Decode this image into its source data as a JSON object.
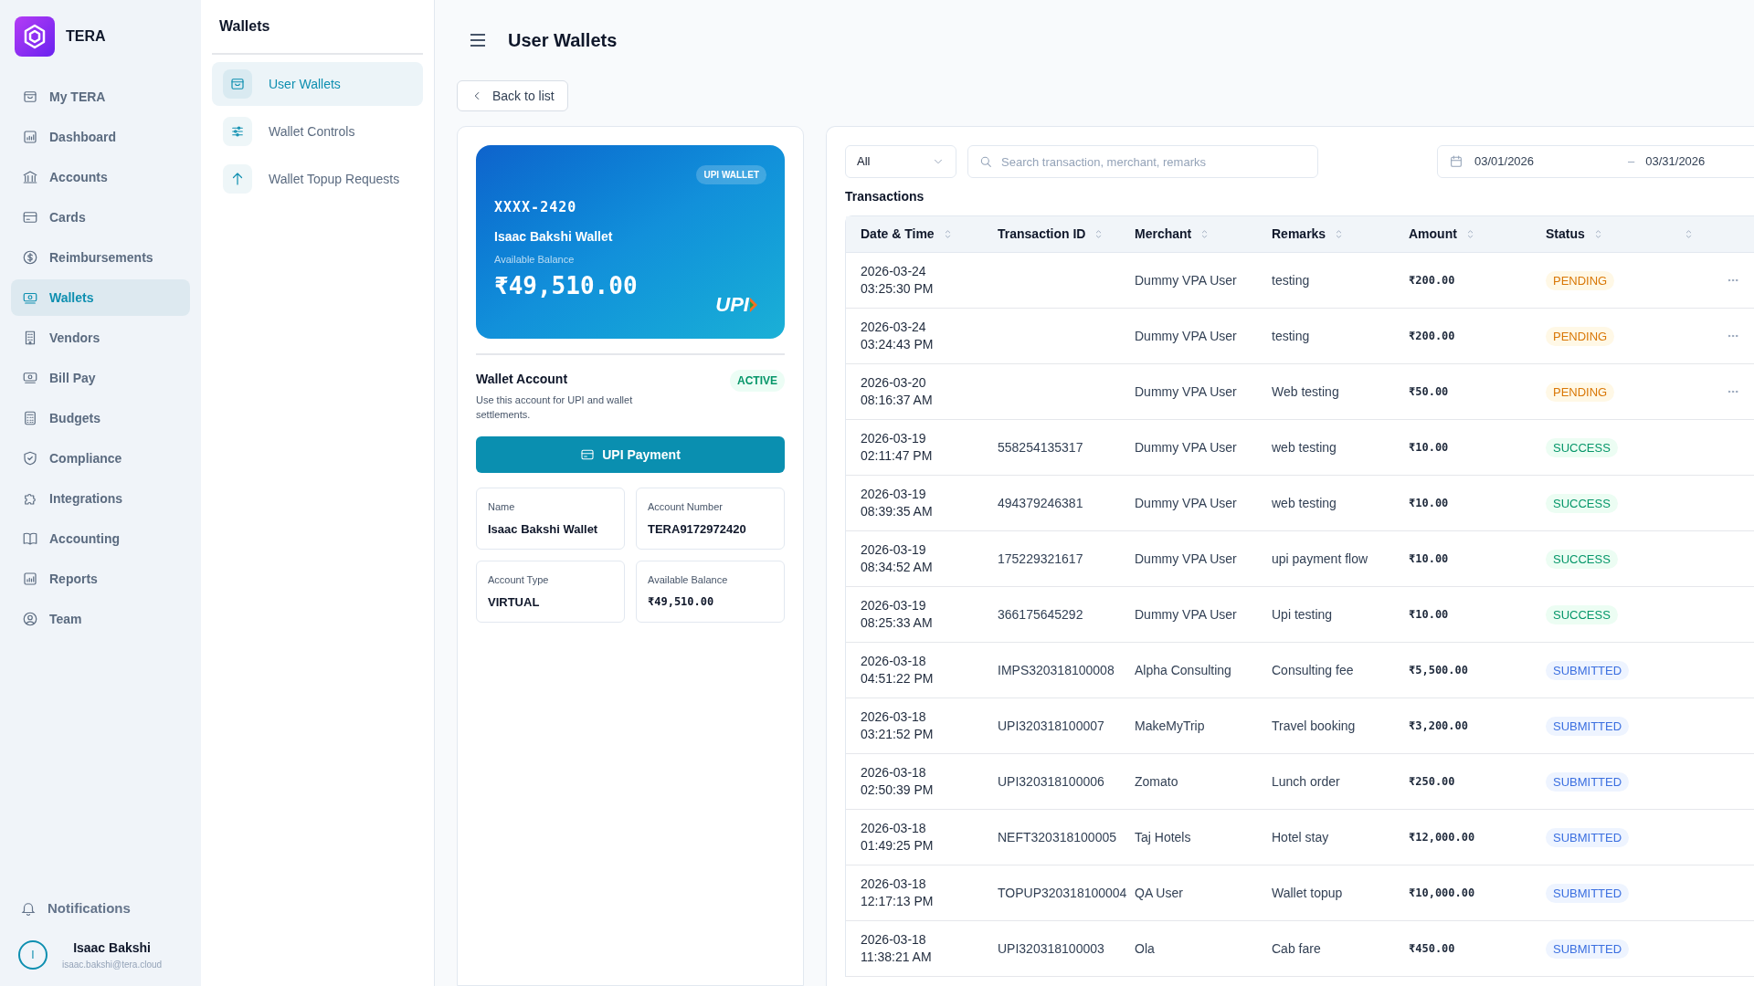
{
  "sidebar": {
    "brand": "TERA",
    "items": [
      {
        "label": "My TERA",
        "selected": false
      },
      {
        "label": "Dashboard",
        "selected": false
      },
      {
        "label": "Accounts",
        "selected": false
      },
      {
        "label": "Cards",
        "selected": false
      },
      {
        "label": "Reimbursements",
        "selected": false
      },
      {
        "label": "Wallets",
        "selected": true
      },
      {
        "label": "Vendors",
        "selected": false
      },
      {
        "label": "Bill Pay",
        "selected": false
      },
      {
        "label": "Budgets",
        "selected": false
      },
      {
        "label": "Compliance",
        "selected": false
      },
      {
        "label": "Integrations",
        "selected": false
      },
      {
        "label": "Accounting",
        "selected": false
      },
      {
        "label": "Reports",
        "selected": false
      },
      {
        "label": "Team",
        "selected": false
      }
    ],
    "notifications": "Notifications",
    "user": {
      "initial": "I",
      "name": "Isaac Bakshi",
      "email": "isaac.bakshi@tera.cloud"
    }
  },
  "subnav": {
    "title": "Wallets",
    "items": [
      {
        "label": "User Wallets",
        "selected": true
      },
      {
        "label": "Wallet Controls",
        "selected": false
      },
      {
        "label": "Wallet Topup Requests",
        "selected": false
      }
    ]
  },
  "header": {
    "title": "User Wallets",
    "back": "Back to list"
  },
  "wallet_card": {
    "badge": "UPI WALLET",
    "number": "XXXX-2420",
    "name": "Isaac Bakshi Wallet",
    "balance_label": "Available Balance",
    "balance": "₹49,510.00",
    "logo": "UPI"
  },
  "account": {
    "title": "Wallet Account",
    "status": "ACTIVE",
    "description": "Use this account for UPI and wallet settlements.",
    "button": "UPI Payment",
    "fields": [
      {
        "label": "Name",
        "value": "Isaac Bakshi Wallet",
        "kind": "text"
      },
      {
        "label": "Account Number",
        "value": "TERA9172972420",
        "kind": "text"
      },
      {
        "label": "Account Type",
        "value": "VIRTUAL",
        "kind": "text"
      },
      {
        "label": "Available Balance",
        "value": "₹49,510.00",
        "kind": "amount"
      }
    ]
  },
  "filters": {
    "type": "All",
    "search_placeholder": "Search transaction, merchant, remarks",
    "date_from": "03/01/2026",
    "date_separator": "–",
    "date_to": "03/31/2026"
  },
  "transactions": {
    "title": "Transactions",
    "columns": [
      "Date & Time",
      "Transaction ID",
      "Merchant",
      "Remarks",
      "Amount",
      "Status"
    ],
    "rows": [
      {
        "date": "2026-03-24",
        "time": "03:25:30 PM",
        "merchant": "Dummy VPA User",
        "remarks": "testing",
        "amount": "₹200.00",
        "status": "PENDING",
        "kind": "pending",
        "menu": true
      },
      {
        "date": "2026-03-24",
        "time": "03:24:43 PM",
        "merchant": "Dummy VPA User",
        "remarks": "testing",
        "amount": "₹200.00",
        "status": "PENDING",
        "kind": "pending",
        "menu": true
      },
      {
        "date": "2026-03-20",
        "time": "08:16:37 AM",
        "merchant": "Dummy VPA User",
        "remarks": "Web testing",
        "amount": "₹50.00",
        "status": "PENDING",
        "kind": "pending",
        "menu": true
      },
      {
        "date": "2026-03-19",
        "time": "02:11:47 PM",
        "id": "558254135317",
        "merchant": "Dummy VPA User",
        "remarks": "web testing",
        "amount": "₹10.00",
        "status": "SUCCESS",
        "kind": "success",
        "menu": false
      },
      {
        "date": "2026-03-19",
        "time": "08:39:35 AM",
        "id": "494379246381",
        "merchant": "Dummy VPA User",
        "remarks": "web testing",
        "amount": "₹10.00",
        "status": "SUCCESS",
        "kind": "success",
        "menu": false
      },
      {
        "date": "2026-03-19",
        "time": "08:34:52 AM",
        "id": "175229321617",
        "merchant": "Dummy VPA User",
        "remarks": "upi payment flow",
        "amount": "₹10.00",
        "status": "SUCCESS",
        "kind": "success",
        "menu": false
      },
      {
        "date": "2026-03-19",
        "time": "08:25:33 AM",
        "id": "366175645292",
        "merchant": "Dummy VPA User",
        "remarks": "Upi testing",
        "amount": "₹10.00",
        "status": "SUCCESS",
        "kind": "success",
        "menu": false
      },
      {
        "date": "2026-03-18",
        "time": "04:51:22 PM",
        "id": "IMPS320318100008",
        "merchant": "Alpha Consulting",
        "remarks": "Consulting fee",
        "amount": "₹5,500.00",
        "status": "SUBMITTED",
        "kind": "submitted",
        "menu": false
      },
      {
        "date": "2026-03-18",
        "time": "03:21:52 PM",
        "id": "UPI320318100007",
        "merchant": "MakeMyTrip",
        "remarks": "Travel booking",
        "amount": "₹3,200.00",
        "status": "SUBMITTED",
        "kind": "submitted",
        "menu": false
      },
      {
        "date": "2026-03-18",
        "time": "02:50:39 PM",
        "id": "UPI320318100006",
        "merchant": "Zomato",
        "remarks": "Lunch order",
        "amount": "₹250.00",
        "status": "SUBMITTED",
        "kind": "submitted",
        "menu": false
      },
      {
        "date": "2026-03-18",
        "time": "01:49:25 PM",
        "id": "NEFT320318100005",
        "merchant": "Taj Hotels",
        "remarks": "Hotel stay",
        "amount": "₹12,000.00",
        "status": "SUBMITTED",
        "kind": "submitted",
        "menu": false
      },
      {
        "date": "2026-03-18",
        "time": "12:17:13 PM",
        "id": "TOPUP320318100004",
        "merchant": "QA User",
        "remarks": "Wallet topup",
        "amount": "₹10,000.00",
        "status": "SUBMITTED",
        "kind": "submitted",
        "menu": false
      },
      {
        "date": "2026-03-18",
        "time": "11:38:21 AM",
        "id": "UPI320318100003",
        "merchant": "Ola",
        "remarks": "Cab fare",
        "amount": "₹450.00",
        "status": "SUBMITTED",
        "kind": "submitted",
        "menu": false
      }
    ]
  }
}
